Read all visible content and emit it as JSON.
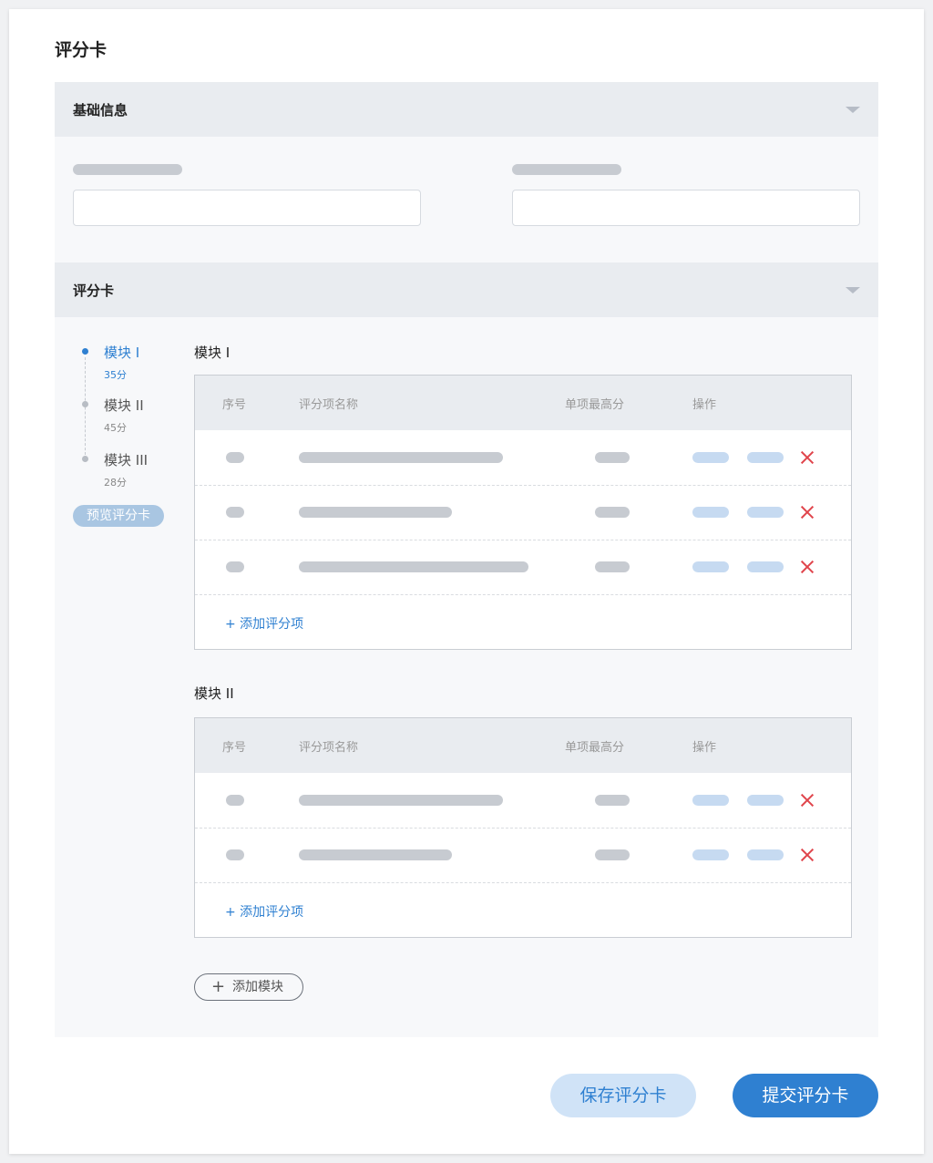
{
  "page": {
    "title": "评分卡"
  },
  "basic_info": {
    "header": "基础信息"
  },
  "scorecard": {
    "header": "评分卡",
    "steps": [
      {
        "name": "模块 I",
        "score": "35分",
        "active": true
      },
      {
        "name": "模块 II",
        "score": "45分",
        "active": false
      },
      {
        "name": "模块 III",
        "score": "28分",
        "active": false
      }
    ],
    "preview_label": "预览评分卡",
    "table_headers": {
      "index": "序号",
      "item_name": "评分项名称",
      "max_score": "单项最高分",
      "actions": "操作"
    },
    "modules": [
      {
        "title": "模块 I",
        "add_item_label": "+ 添加评分项"
      },
      {
        "title": "模块 II",
        "add_item_label": "+ 添加评分项"
      }
    ],
    "add_module_label": "添加模块"
  },
  "footer": {
    "save_label": "保存评分卡",
    "submit_label": "提交评分卡"
  },
  "colors": {
    "accent": "#2f80d1",
    "delete": "#e0454c",
    "header_bg": "#e9ecf0",
    "section_bg": "#f7f8fa"
  },
  "icons": {
    "collapse": "caret-down-icon",
    "delete": "close-x-icon",
    "add": "plus-icon"
  }
}
